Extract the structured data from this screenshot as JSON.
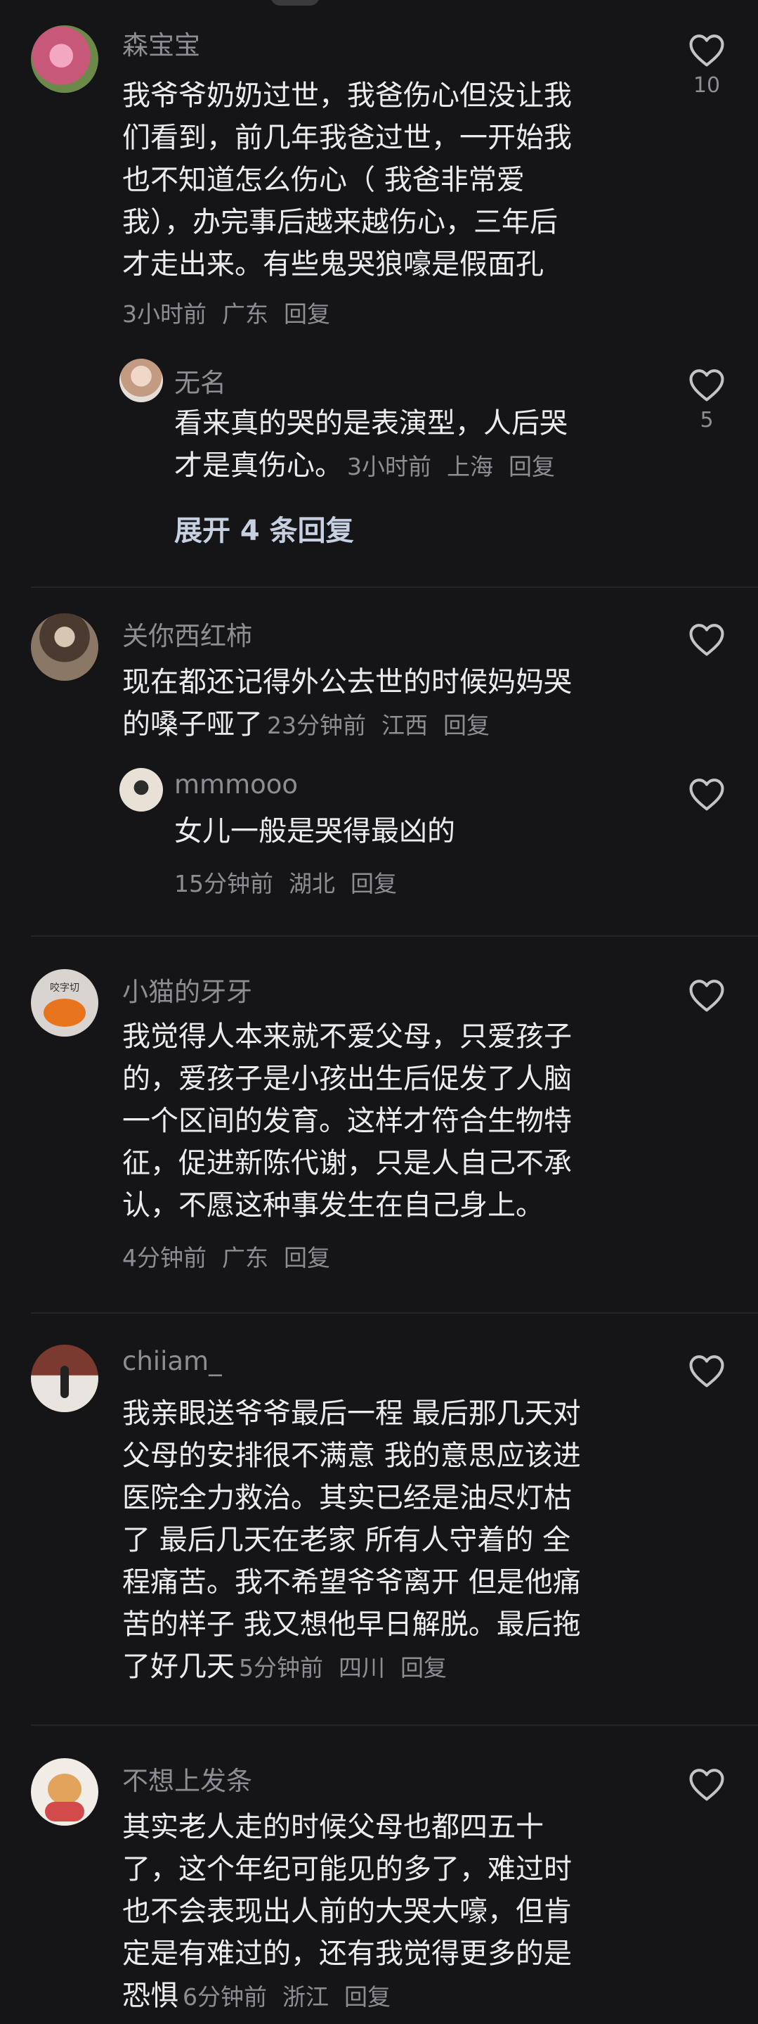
{
  "comments": [
    {
      "username": "森宝宝",
      "lines": [
        "我爷爷奶奶过世，我爸伤心但没让我",
        "们看到，前几年我爸过世，一开始我",
        "也不知道怎么伤心（ 我爸非常爱",
        "我），办完事后越来越伤心，三年后",
        "才走出来。有些鬼哭狼嚎是假面孔"
      ],
      "time": "3小时前",
      "location": "广东",
      "reply_label": "回复",
      "likes": "10",
      "avatar_color": "#c8587a",
      "replies": [
        {
          "username": "无名",
          "lines": [
            "看来真的哭的是表演型，人后哭",
            "才是真伤心。"
          ],
          "time": "3小时前",
          "location": "上海",
          "reply_label": "回复",
          "likes": "5",
          "avatar_color": "#d7b9a6"
        }
      ],
      "expand_label": "展开 4 条回复"
    },
    {
      "username": "关你西红柿",
      "lines": [
        "现在都还记得外公去世的时候妈妈哭",
        "的嗓子哑了"
      ],
      "time": "23分钟前",
      "location": "江西",
      "reply_label": "回复",
      "likes": "",
      "avatar_color": "#6e5b4d",
      "replies": [
        {
          "username": "mmmooo",
          "lines": [
            "女儿一般是哭得最凶的"
          ],
          "time": "15分钟前",
          "location": "湖北",
          "reply_label": "回复",
          "likes": "",
          "avatar_color": "#e8e2d6"
        }
      ]
    },
    {
      "username": "小猫的牙牙",
      "lines": [
        "我觉得人本来就不爱父母，只爱孩子",
        "的，爱孩子是小孩出生后促发了人脑",
        "一个区间的发育。这样才符合生物特",
        "征，促进新陈代谢，只是人自己不承",
        "认，不愿这种事发生在自己身上。"
      ],
      "time": "4分钟前",
      "location": "广东",
      "reply_label": "回复",
      "likes": "",
      "avatar_color": "#d9d4cf",
      "avatar_text": "咬字切"
    },
    {
      "username": "chiiam_",
      "lines": [
        "我亲眼送爷爷最后一程 最后那几天对",
        "父母的安排很不满意 我的意思应该进",
        "医院全力救治。其实已经是油尽灯枯",
        "了 最后几天在老家 所有人守着的 全",
        "程痛苦。我不希望爷爷离开 但是他痛",
        "苦的样子 我又想他早日解脱。最后拖",
        "了好几天"
      ],
      "time": "5分钟前",
      "location": "四川",
      "reply_label": "回复",
      "likes": "",
      "avatar_color": "#8a4a3c"
    },
    {
      "username": "不想上发条",
      "lines": [
        "其实老人走的时候父母也都四五十",
        "了，这个年纪可能见的多了，难过时",
        "也不会表现出人前的大哭大嚎，但肯",
        "定是有难过的，还有我觉得更多的是",
        "恐惧"
      ],
      "time": "6分钟前",
      "location": "浙江",
      "reply_label": "回复",
      "likes": "",
      "avatar_color": "#f1ece6"
    }
  ],
  "icons": {
    "like": "heart-outline-icon"
  },
  "colors": {
    "background": "#151517",
    "text": "#ececee",
    "meta": "#8d8d93",
    "expand": "#c7d0e0"
  }
}
